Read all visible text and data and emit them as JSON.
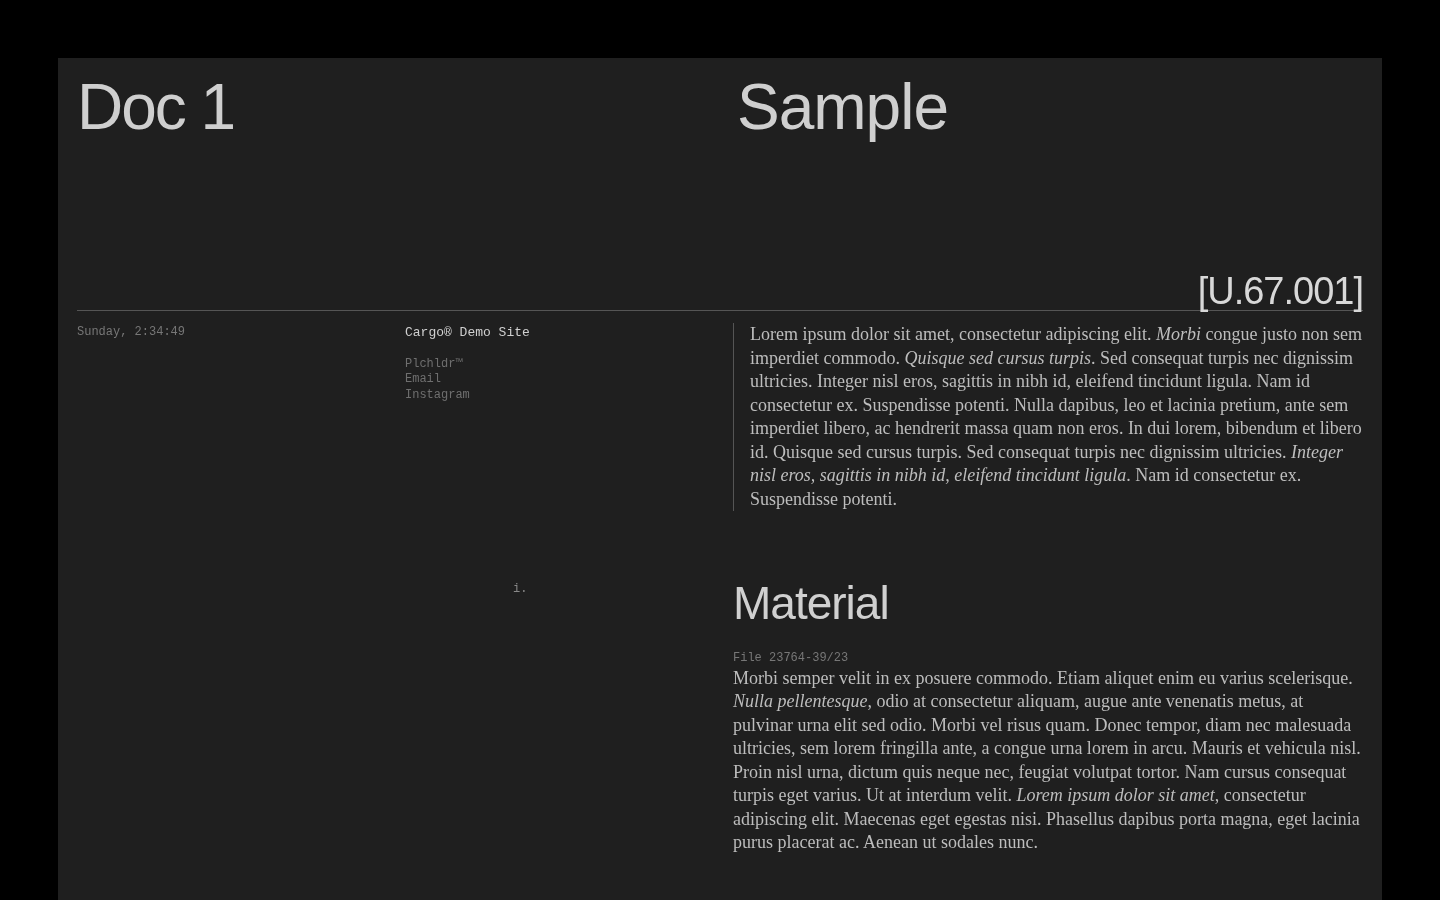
{
  "header": {
    "title_left": "Doc 1",
    "title_right": "Sample",
    "code": "[U.67.001]"
  },
  "info": {
    "datetime": "Sunday, 2:34:49",
    "site_name": "Cargo® Demo Site",
    "links": [
      "Plchldr™",
      "Email",
      "Instagram"
    ],
    "marker": "i."
  },
  "intro": "Lorem ipsum dolor sit amet, consectetur adipiscing elit. *Morbi* congue justo non sem imperdiet commodo. *Quisque sed cursus turpis*. Sed consequat turpis nec dignissim ultricies. Integer nisl eros, sagittis in nibh id, eleifend tincidunt ligula. Nam id consectetur ex. Suspendisse potenti. Nulla dapibus, leo et lacinia pretium, ante sem imperdiet libero, ac hendrerit massa quam non eros. In dui lorem, bibendum et libero id. Quisque sed cursus turpis. Sed consequat turpis nec dignissim ultricies. *Integer nisl eros, sagittis in nibh id, eleifend tincidunt ligula*. Nam id consectetur ex. Suspendisse potenti.",
  "section": {
    "heading": "Material",
    "file": "File 23764-39/23",
    "body": "Morbi semper velit in ex posuere commodo. Etiam aliquet enim eu varius scelerisque. *Nulla pellentesque*, odio at consectetur aliquam, augue ante venenatis metus, at pulvinar urna elit sed odio. Morbi vel risus quam. Donec tempor, diam nec malesuada ultricies, sem lorem fringilla ante, a congue urna lorem in arcu. Mauris et vehicula nisl. Proin nisl urna, dictum quis neque nec, feugiat volutpat tortor. Nam cursus consequat turpis eget varius. Ut at interdum velit. *Lorem ipsum dolor sit amet*, consectetur adipiscing elit. Maecenas eget egestas nisi. Phasellus dapibus porta magna, eget lacinia purus placerat ac. Aenean ut sodales nunc."
  }
}
